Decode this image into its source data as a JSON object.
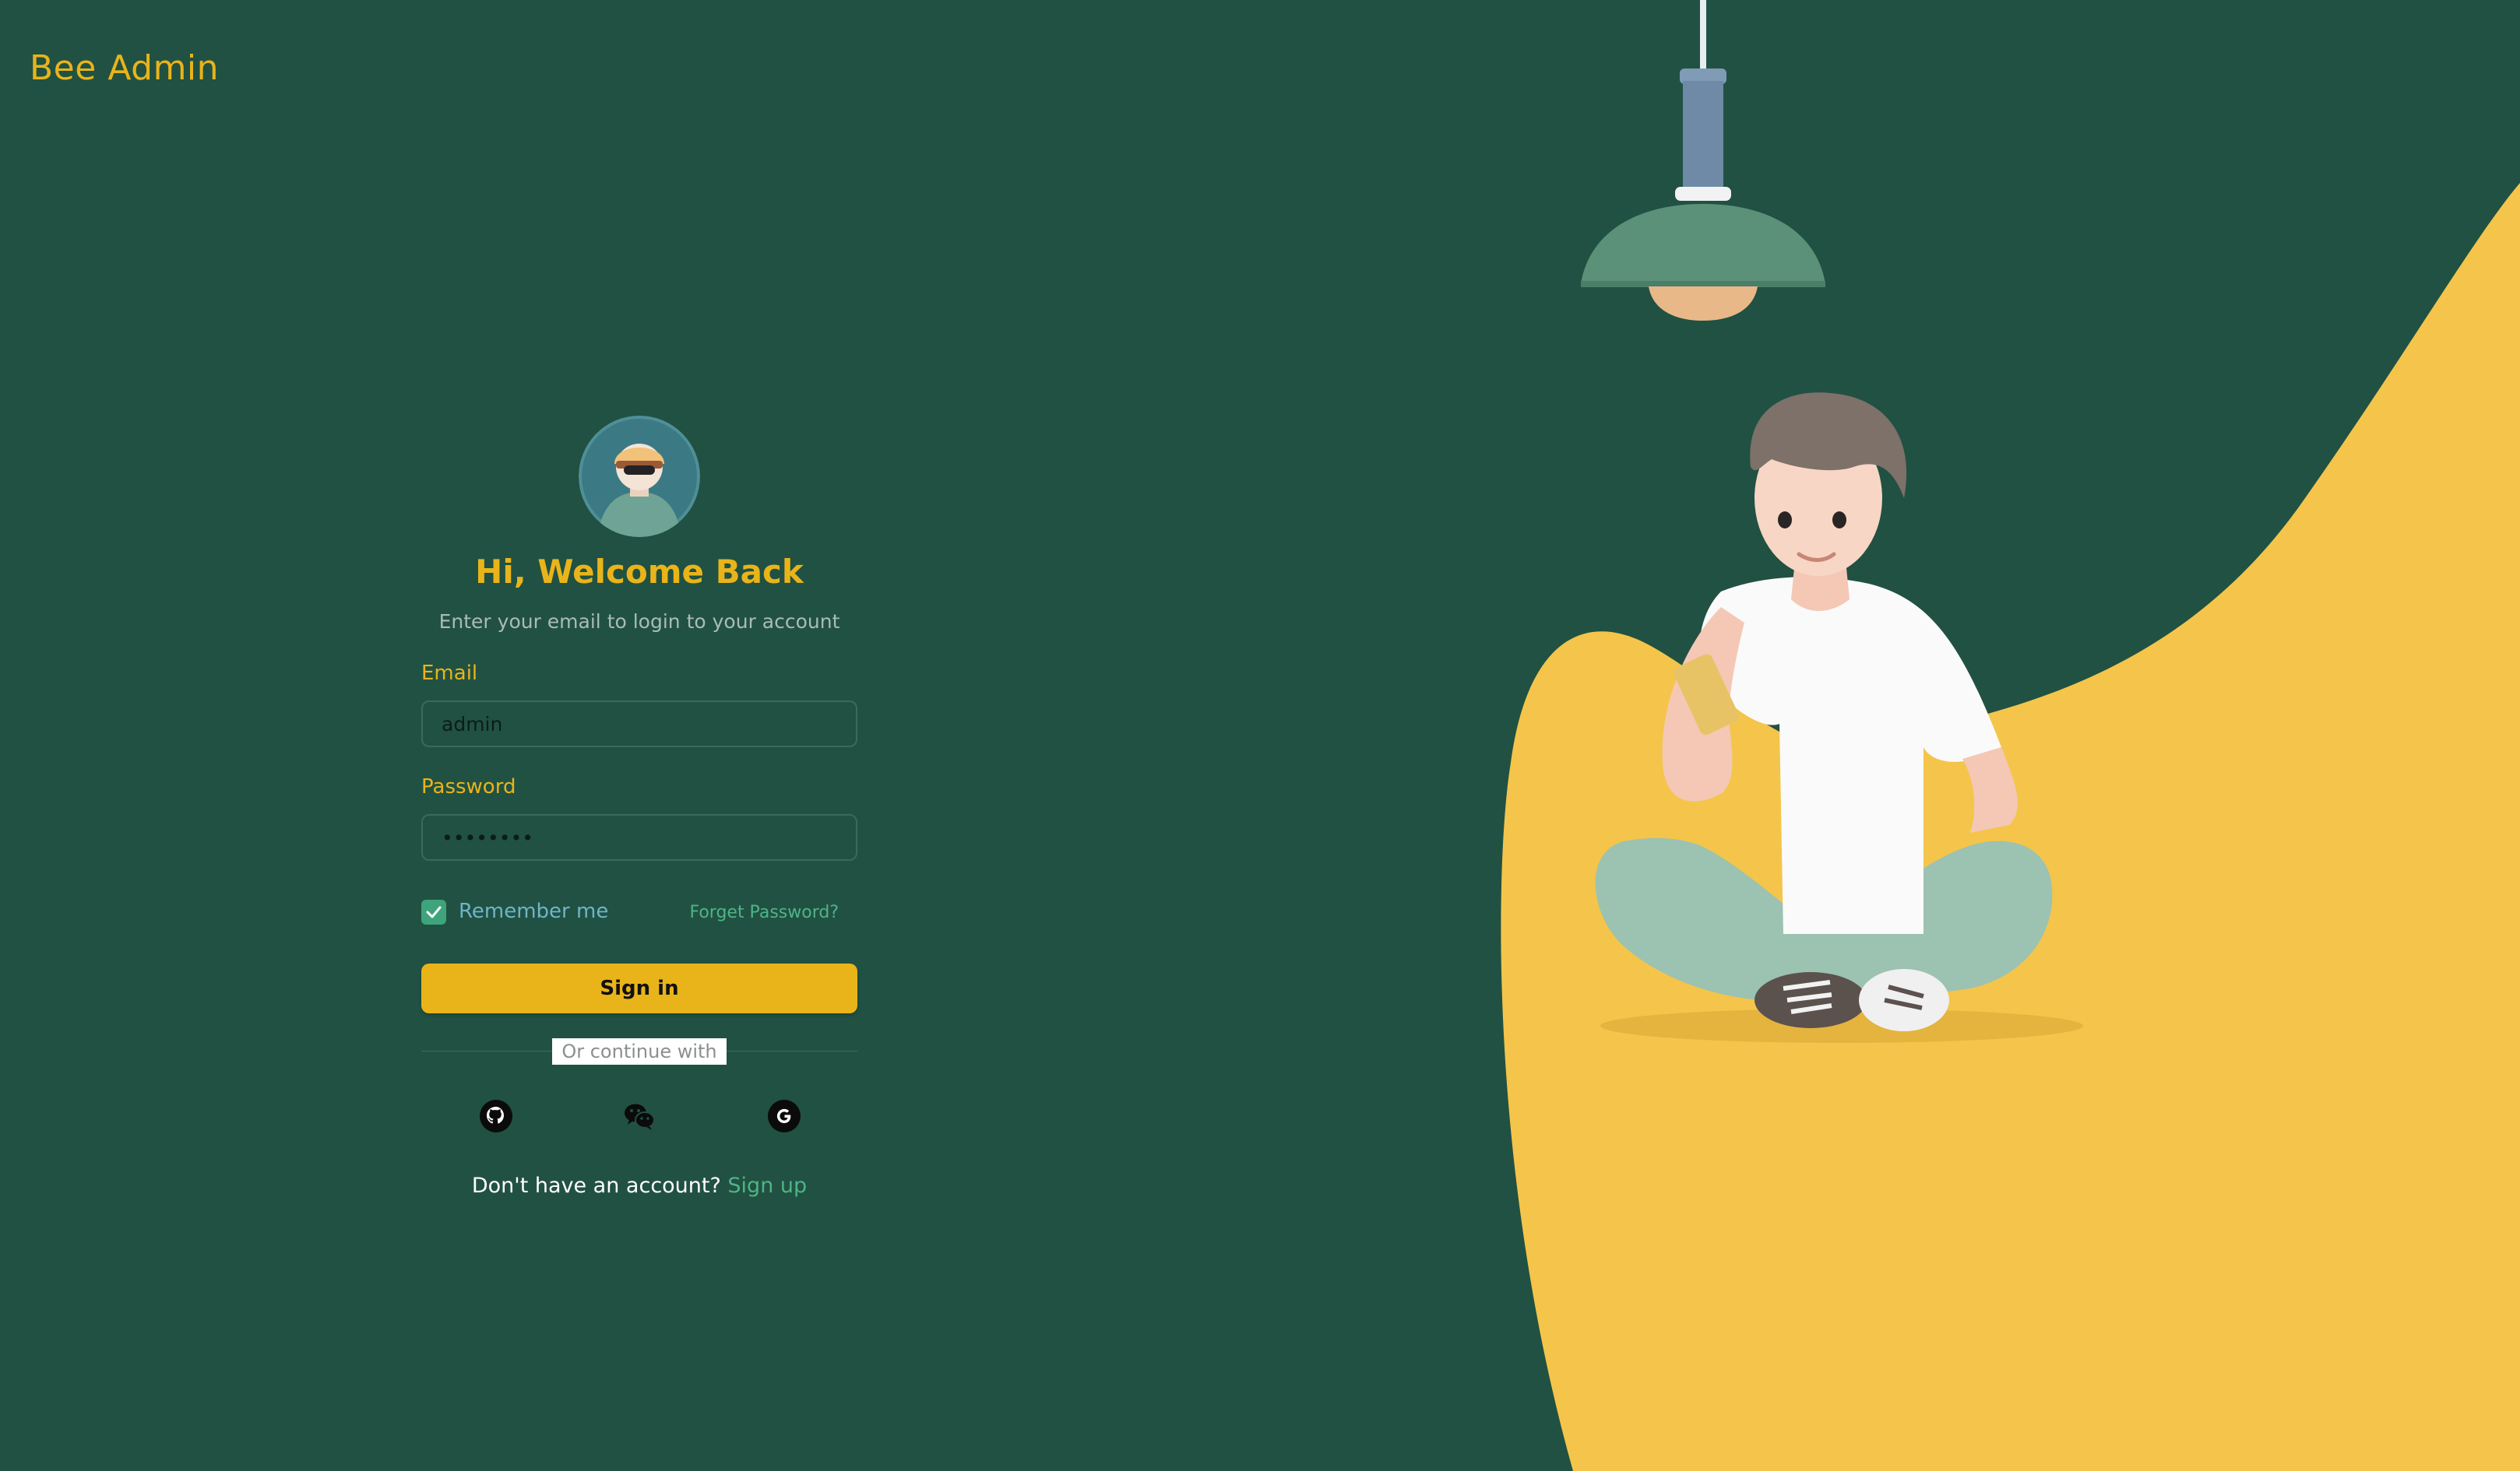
{
  "app": {
    "brand": "Bee Admin"
  },
  "login": {
    "title": "Hi, Welcome Back",
    "subtitle": "Enter your email to login to your account",
    "email_label": "Email",
    "email_value": "admin",
    "password_label": "Password",
    "password_value": "••••••••",
    "remember_label": "Remember me",
    "remember_checked": true,
    "forgot_label": "Forget Password?",
    "signin_label": "Sign in",
    "divider_label": "Or continue with",
    "socials": [
      {
        "name": "github",
        "icon": "github-icon"
      },
      {
        "name": "wechat",
        "icon": "wechat-icon"
      },
      {
        "name": "google",
        "icon": "google-icon"
      }
    ],
    "signup_prompt": "Don't have an account?",
    "signup_label": "Sign up"
  },
  "colors": {
    "background": "#215142",
    "accent": "#e9b41a",
    "link": "#4fb487",
    "illustration_yellow": "#f4c54a"
  }
}
